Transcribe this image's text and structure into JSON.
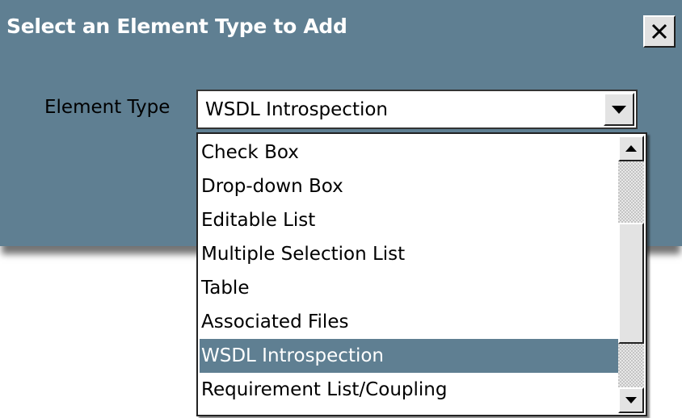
{
  "dialog": {
    "title": "Select an Element Type to Add",
    "close_label": "×"
  },
  "form": {
    "label": "Element Type",
    "selected_value": "WSDL Introspection"
  },
  "dropdown": {
    "items": [
      "Check Box",
      "Drop-down Box",
      "Editable List",
      "Multiple Selection List",
      "Table",
      "Associated Files",
      "WSDL Introspection",
      "Requirement List/Coupling"
    ],
    "selected_index": 6
  },
  "icons": {
    "close": "close-icon",
    "combo_arrow": "chevron-down-icon",
    "scroll_up": "scroll-up-arrow-icon",
    "scroll_down": "scroll-down-arrow-icon"
  },
  "colors": {
    "dialog_background": "#5f7f92",
    "selection_highlight": "#5f7f92",
    "title_text": "#ffffff"
  }
}
